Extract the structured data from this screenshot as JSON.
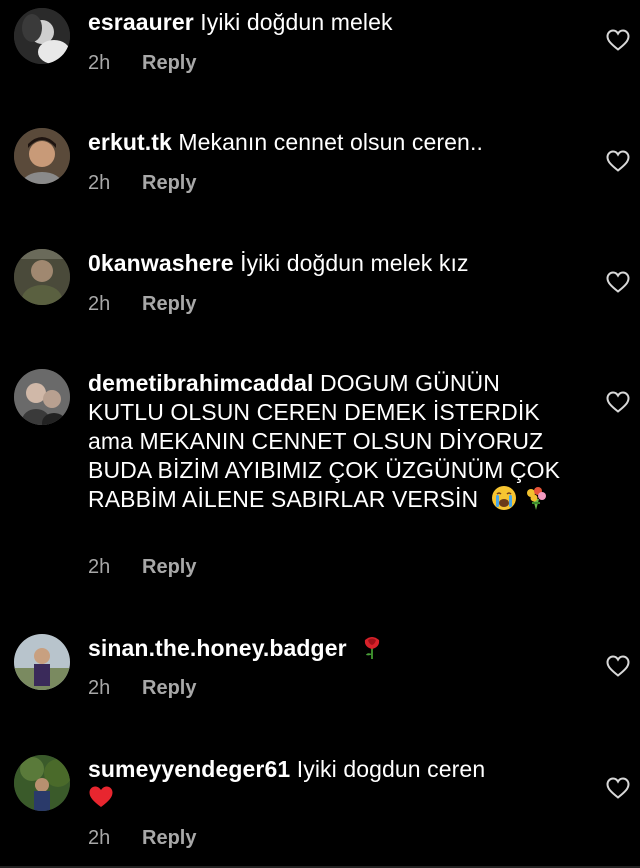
{
  "comments": [
    {
      "username": "esraaurer",
      "text": "Iyiki doğdun melek",
      "time": "2h",
      "reply": "Reply"
    },
    {
      "username": "erkut.tk",
      "text": "Mekanın cennet olsun ceren..",
      "time": "2h",
      "reply": "Reply"
    },
    {
      "username": "0kanwashere",
      "text": "İyiki doğdun melek kız",
      "time": "2h",
      "reply": "Reply"
    },
    {
      "username": "demetibrahimcaddal",
      "text": "DOGUM GÜNÜN KUTLU OLSUN CEREN DEMEK İSTERDİK ama MEKANIN CENNET OLSUN DİYORUZ BUDA BİZİM AYIBIMIZ ÇOK ÜZGÜNÜM ÇOK RABBİM AİLENE SABIRLAR VERSİN",
      "time": "2h",
      "reply": "Reply",
      "emojis": [
        "crying-face-emoji",
        "bouquet-emoji"
      ]
    },
    {
      "username": "sinan.the.honey.badger",
      "text": "",
      "time": "2h",
      "reply": "Reply",
      "emojis": [
        "rose-emoji"
      ]
    },
    {
      "username": "sumeyyendeger61",
      "text": "Iyiki dogdun ceren",
      "time": "2h",
      "reply": "Reply",
      "emojis": [
        "red-heart-emoji"
      ]
    }
  ],
  "icons": {
    "like": "heart-outline-icon"
  },
  "colors": {
    "background": "#000000",
    "text": "#ffffff",
    "meta": "#a8a8a8"
  }
}
